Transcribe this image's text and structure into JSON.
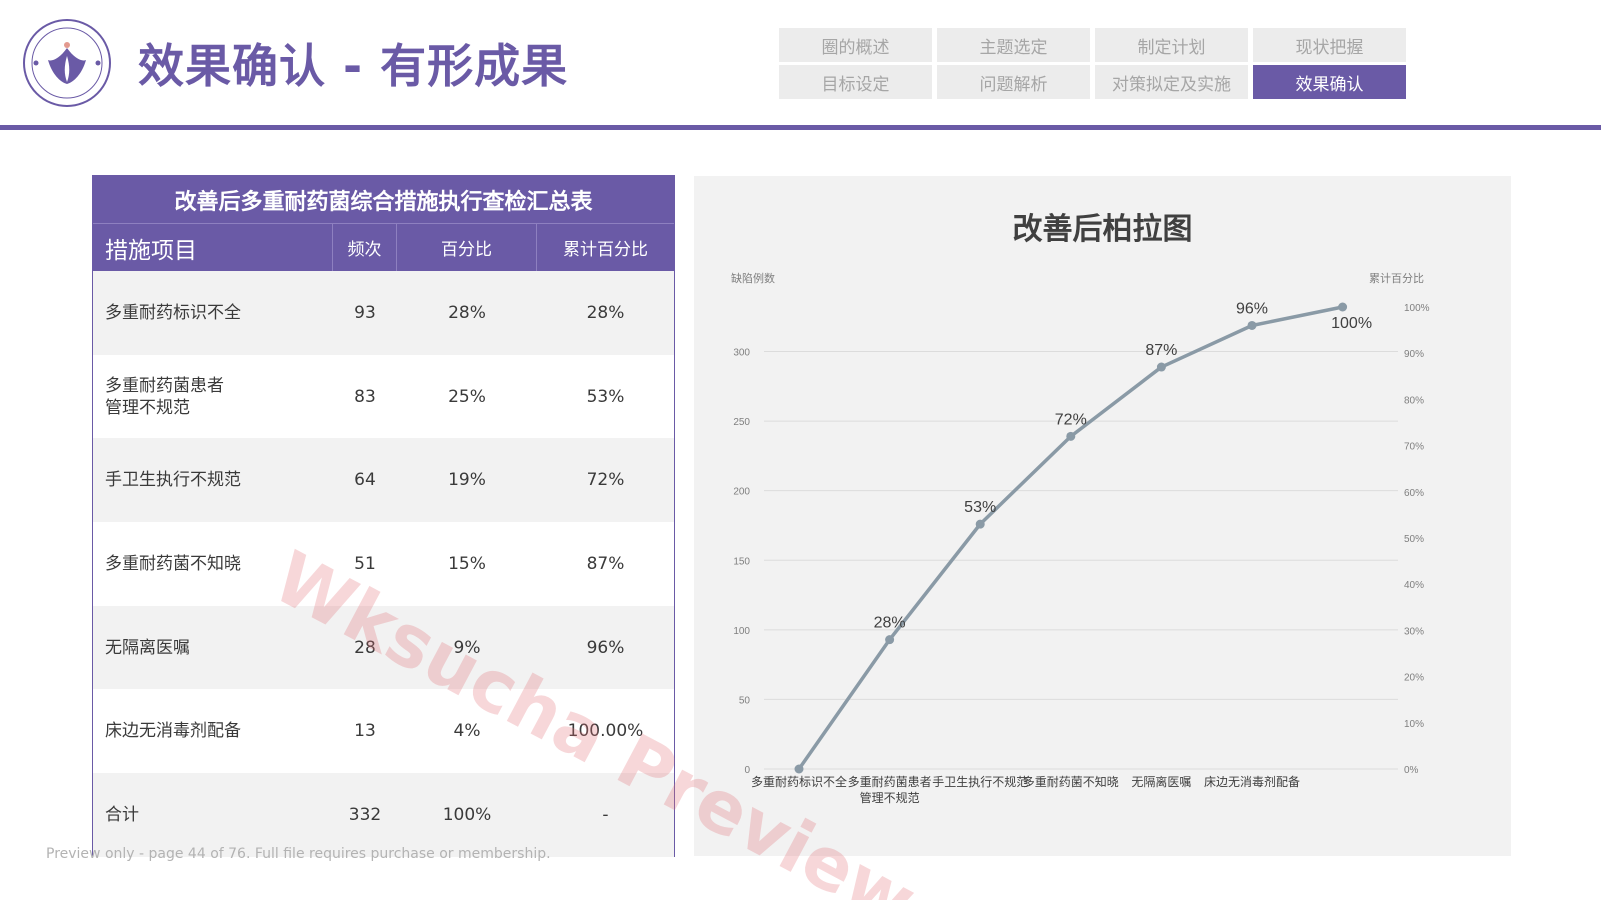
{
  "header": {
    "title": "效果确认 - 有形成果",
    "logo_icon": "hospital-logo-icon"
  },
  "nav": {
    "tabs": [
      {
        "label": "圈的概述",
        "active": false
      },
      {
        "label": "主题选定",
        "active": false
      },
      {
        "label": "制定计划",
        "active": false
      },
      {
        "label": "现状把握",
        "active": false
      },
      {
        "label": "目标设定",
        "active": false
      },
      {
        "label": "问题解析",
        "active": false
      },
      {
        "label": "对策拟定及实施",
        "active": false
      },
      {
        "label": "效果确认",
        "active": true
      }
    ]
  },
  "table": {
    "caption": "改善后多重耐药菌综合措施执行查检汇总表",
    "headers": [
      "措施项目",
      "频次",
      "百分比",
      "累计百分比"
    ],
    "rows": [
      {
        "item": "多重耐药标识不全",
        "freq": "93",
        "pct": "28%",
        "cum": "28%"
      },
      {
        "item": "多重耐药菌患者\n管理不规范",
        "freq": "83",
        "pct": "25%",
        "cum": "53%"
      },
      {
        "item": "手卫生执行不规范",
        "freq": "64",
        "pct": "19%",
        "cum": "72%"
      },
      {
        "item": "多重耐药菌不知晓",
        "freq": "51",
        "pct": "15%",
        "cum": "87%"
      },
      {
        "item": "无隔离医嘱",
        "freq": "28",
        "pct": "9%",
        "cum": "96%"
      },
      {
        "item": "床边无消毒剂配备",
        "freq": "13",
        "pct": "4%",
        "cum": "100.00%"
      },
      {
        "item": "合计",
        "freq": "332",
        "pct": "100%",
        "cum": "-"
      }
    ]
  },
  "chart_data": {
    "type": "line",
    "title": "改善后柏拉图",
    "ylabel": "缺陷例数",
    "y2label": "累计百分比",
    "categories": [
      "多重耐药标识不全",
      "多重耐药菌患者管理不规范",
      "手卫生执行不规范",
      "多重耐药菌不知晓",
      "无隔离医嘱",
      "床边无消毒剂配备"
    ],
    "category_tick_labels": [
      [
        "多重耐药标识不全"
      ],
      [
        "多重耐药菌患者",
        "管理不规范"
      ],
      [
        "手卫生执行不规范"
      ],
      [
        "多重耐药菌不知晓"
      ],
      [
        "无隔离医嘱"
      ],
      [
        "床边无消毒剂配备"
      ]
    ],
    "series": [
      {
        "name": "累计百分比",
        "x_positions": [
          0,
          1,
          2,
          3,
          4,
          5,
          6
        ],
        "values": [
          0,
          28,
          53,
          72,
          87,
          96,
          100
        ],
        "labels": [
          "",
          "28%",
          "53%",
          "72%",
          "87%",
          "96%",
          "100%"
        ]
      }
    ],
    "y_ticks": [
      "0",
      "50",
      "100",
      "150",
      "200",
      "250",
      "300"
    ],
    "y_range": [
      0,
      332
    ],
    "y2_ticks": [
      "0%",
      "10%",
      "20%",
      "30%",
      "40%",
      "50%",
      "60%",
      "70%",
      "80%",
      "90%",
      "100%"
    ],
    "y2_range": [
      0,
      100
    ],
    "line_color": "#8a9aa6",
    "grid": true
  },
  "footer": {
    "preview_note": "Preview only - page 44 of 76. Full file requires purchase or membership.",
    "watermark": "Wksucha Preview"
  },
  "colors": {
    "accent": "#6a5aa6",
    "tab_inactive_bg": "#ececec",
    "tab_inactive_text": "#a6a6a6"
  }
}
